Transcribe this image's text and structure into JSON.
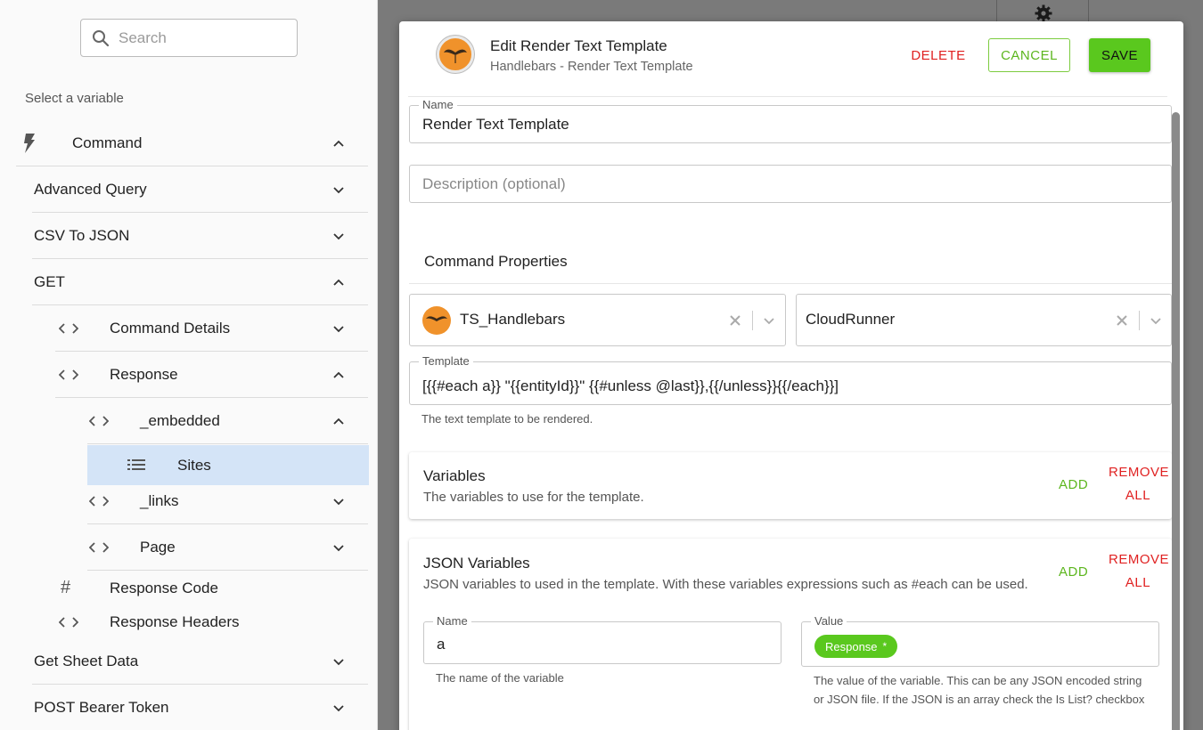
{
  "left_panel": {
    "search": {
      "placeholder": "Search"
    },
    "select_label": "Select a variable",
    "items": [
      {
        "label": "Command"
      },
      {
        "label": "Advanced Query"
      },
      {
        "label": "CSV To JSON"
      },
      {
        "label": "GET"
      },
      {
        "label": "Command Details"
      },
      {
        "label": "Response"
      },
      {
        "label": "_embedded"
      },
      {
        "label": "Sites"
      },
      {
        "label": "_links"
      },
      {
        "label": "Page"
      },
      {
        "label": "Response Code"
      },
      {
        "label": "Response Headers"
      },
      {
        "label": "Get Sheet Data"
      },
      {
        "label": "POST Bearer Token"
      }
    ]
  },
  "dialog": {
    "title": "Edit Render Text Template",
    "subtitle": "Handlebars - Render Text Template",
    "delete_label": "DELETE",
    "cancel_label": "CANCEL",
    "save_label": "SAVE",
    "name_field": {
      "legend": "Name",
      "value": "Render Text Template"
    },
    "description_field": {
      "placeholder": "Description (optional)"
    },
    "command_properties_label": "Command Properties",
    "connector_select": {
      "value": "TS_Handlebars"
    },
    "runner_select": {
      "value": "CloudRunner"
    },
    "template_field": {
      "legend": "Template",
      "value": "[{{#each a}} \"{{entityId}}\" {{#unless @last}},{{/unless}}{{/each}}]",
      "help": "The text template to be rendered."
    },
    "variables_card": {
      "title": "Variables",
      "description": "The variables to use for the template.",
      "add_label": "ADD",
      "remove_line1": "REMOVE",
      "remove_line2": "ALL"
    },
    "json_variables_card": {
      "title": "JSON Variables",
      "description": "JSON variables to used in the template. With these variables expressions such as #each can be used.",
      "add_label": "ADD",
      "remove_line1": "REMOVE",
      "remove_line2": "ALL",
      "name_field": {
        "legend": "Name",
        "value": "a",
        "help": "The name of the variable"
      },
      "value_field": {
        "legend": "Value",
        "chip_label": "Response",
        "help_line1": "The value of the variable. This can be any JSON encoded string",
        "help_line2": "or JSON file. If the JSON is an array check the Is List? checkbox"
      }
    }
  },
  "colors": {
    "accent_green": "#5ac81e",
    "danger_red": "#e02222",
    "selected_row": "#d4e4f7",
    "avatar_orange": "#f0922b"
  }
}
